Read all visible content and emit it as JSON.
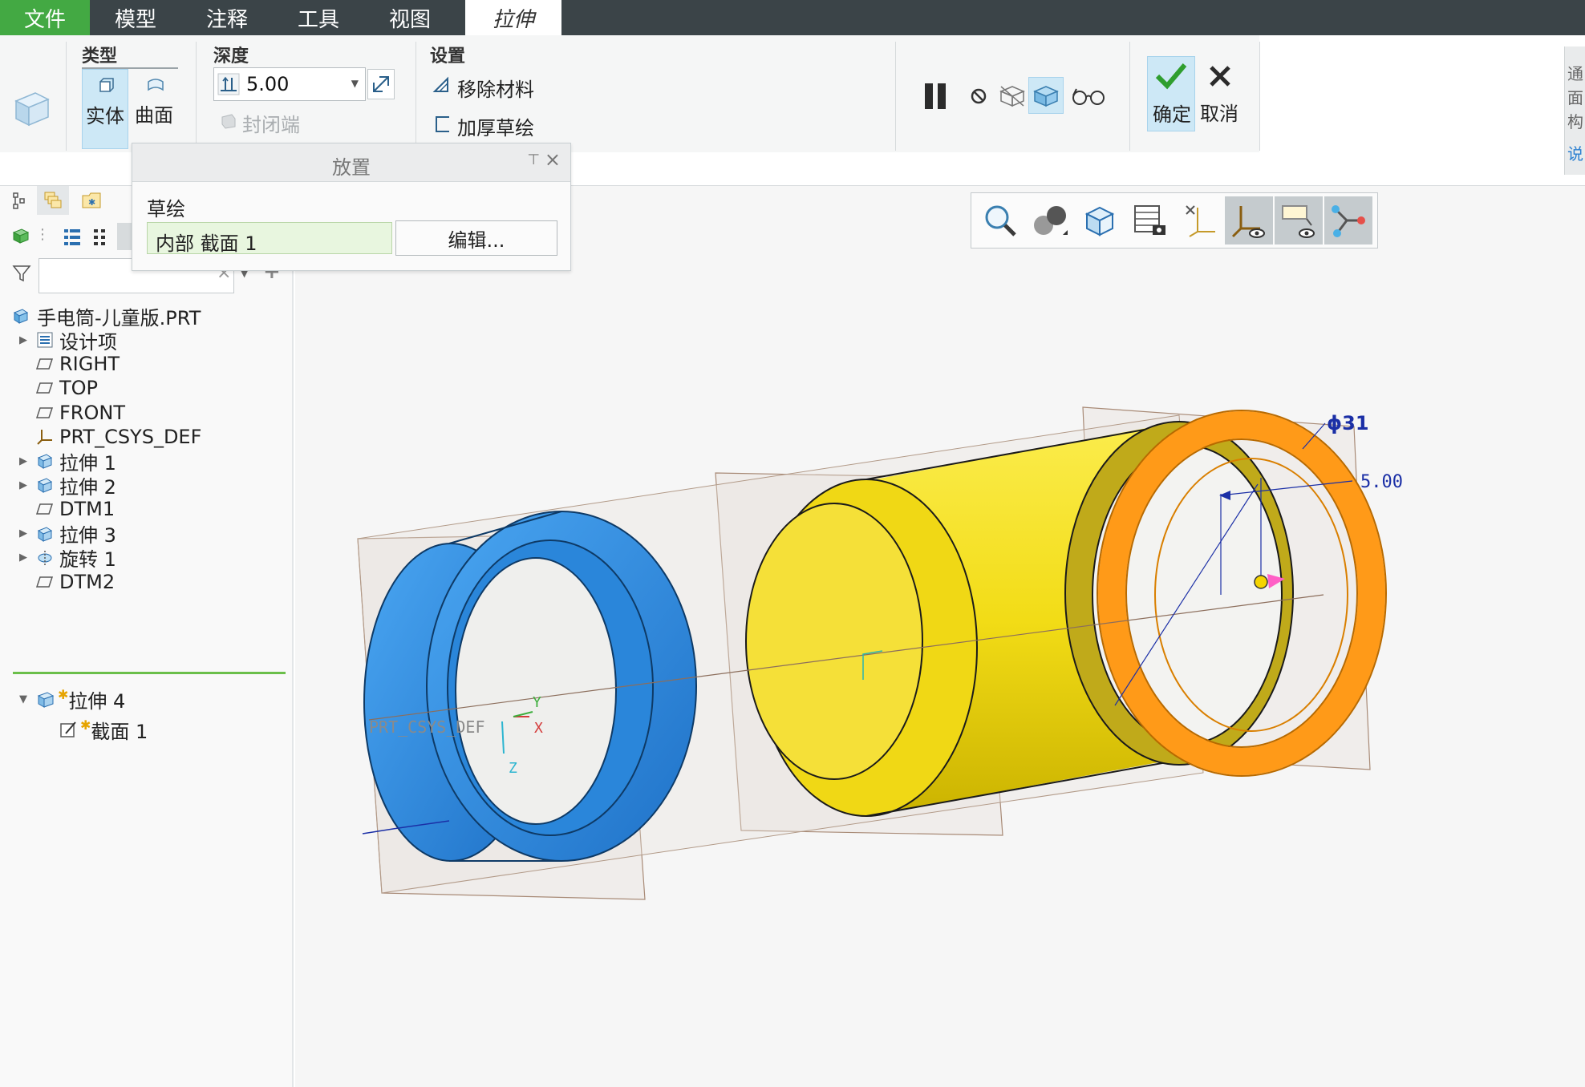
{
  "menu": {
    "file": "文件",
    "model": "模型",
    "annotate": "注释",
    "tools": "工具",
    "view": "视图",
    "extrude_tab": "拉伸"
  },
  "ribbon": {
    "type_group": {
      "title": "类型",
      "solid": "实体",
      "surface": "曲面"
    },
    "depth_group": {
      "title": "深度",
      "value": "5.00",
      "capped_ends": "封闭端"
    },
    "settings_group": {
      "title": "设置",
      "remove_material": "移除材料",
      "thicken_sketch": "加厚草绘"
    },
    "confirm": "确定",
    "cancel": "取消"
  },
  "placement_panel": {
    "title": "放置",
    "sketch_label": "草绘",
    "sketch_value": "内部 截面 1",
    "edit_button": "编辑..."
  },
  "model_tree": {
    "filter_placeholder": "",
    "root": "手电筒-儿童版.PRT",
    "items": [
      {
        "label": "设计项",
        "icon": "layers-icon",
        "expandable": true
      },
      {
        "label": "RIGHT",
        "icon": "datum-plane-icon",
        "expandable": false
      },
      {
        "label": "TOP",
        "icon": "datum-plane-icon",
        "expandable": false
      },
      {
        "label": "FRONT",
        "icon": "datum-plane-icon",
        "expandable": false
      },
      {
        "label": "PRT_CSYS_DEF",
        "icon": "csys-icon",
        "expandable": false
      },
      {
        "label": "拉伸 1",
        "icon": "extrude-icon",
        "expandable": true
      },
      {
        "label": "拉伸 2",
        "icon": "extrude-icon",
        "expandable": true
      },
      {
        "label": "DTM1",
        "icon": "datum-plane-icon",
        "expandable": false
      },
      {
        "label": "拉伸 3",
        "icon": "extrude-icon",
        "expandable": true
      },
      {
        "label": "旋转 1",
        "icon": "revolve-icon",
        "expandable": true
      },
      {
        "label": "DTM2",
        "icon": "datum-plane-icon",
        "expandable": false
      }
    ],
    "active_feature": "拉伸 4",
    "active_child": "截面 1"
  },
  "viewport": {
    "dimension_diameter": "ϕ31",
    "dimension_depth": "5.00",
    "csys_label": "PRT_CSYS_DEF",
    "axis_x": "X",
    "axis_y": "Y",
    "axis_z": "Z"
  },
  "right_stub_chars": [
    "通",
    "面",
    "构",
    "说"
  ],
  "colors": {
    "accent_green": "#43a943",
    "menu_bg": "#3b4448",
    "selected_blue": "#cde8f6",
    "part_blue": "#2f8fe6",
    "part_yellow": "#f3dc17",
    "part_orange": "#ff9a18"
  }
}
